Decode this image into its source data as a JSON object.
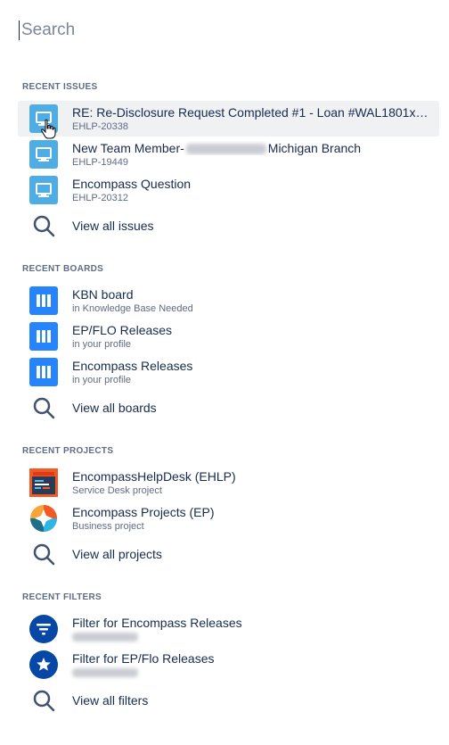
{
  "search": {
    "placeholder": "Search"
  },
  "recent_issues": {
    "title": "RECENT ISSUES",
    "items": [
      {
        "title": "RE: Re-Disclosure Request Completed #1 - Loan #WAL1801x55...",
        "key": "EHLP-20338",
        "icon": "monitor-icon"
      },
      {
        "title_prefix": "New Team Member-",
        "title_suffix": "Michigan Branch",
        "key": "EHLP-19449",
        "icon": "monitor-icon"
      },
      {
        "title": "Encompass Question",
        "key": "EHLP-20312",
        "icon": "monitor-icon"
      }
    ],
    "view_all": "View all issues"
  },
  "recent_boards": {
    "title": "RECENT BOARDS",
    "items": [
      {
        "title": "KBN board",
        "sub": "in Knowledge Base Needed",
        "icon": "board-columns-icon"
      },
      {
        "title": "EP/FLO Releases",
        "sub": "in your profile",
        "icon": "board-columns-icon"
      },
      {
        "title": "Encompass Releases",
        "sub": "in your profile",
        "icon": "board-columns-icon"
      }
    ],
    "view_all": "View all boards"
  },
  "recent_projects": {
    "title": "RECENT PROJECTS",
    "items": [
      {
        "title": "EncompassHelpDesk (EHLP)",
        "sub": "Service Desk project",
        "icon": "service-desk-project-icon"
      },
      {
        "title": "Encompass Projects (EP)",
        "sub": "Business project",
        "icon": "business-project-icon"
      }
    ],
    "view_all": "View all projects"
  },
  "recent_filters": {
    "title": "RECENT FILTERS",
    "items": [
      {
        "title": "Filter for Encompass Releases",
        "icon": "filter-icon"
      },
      {
        "title": "Filter for EP/Flo Releases",
        "icon": "star-filter-icon"
      }
    ],
    "view_all": "View all filters"
  },
  "colors": {
    "issue_icon": "#4fade6",
    "board_icon": "#2684ff",
    "filter_icon": "#0747a6",
    "text_primary": "#172b4d",
    "text_secondary": "#5e6c84",
    "hover_bg": "#f0f1f3"
  }
}
